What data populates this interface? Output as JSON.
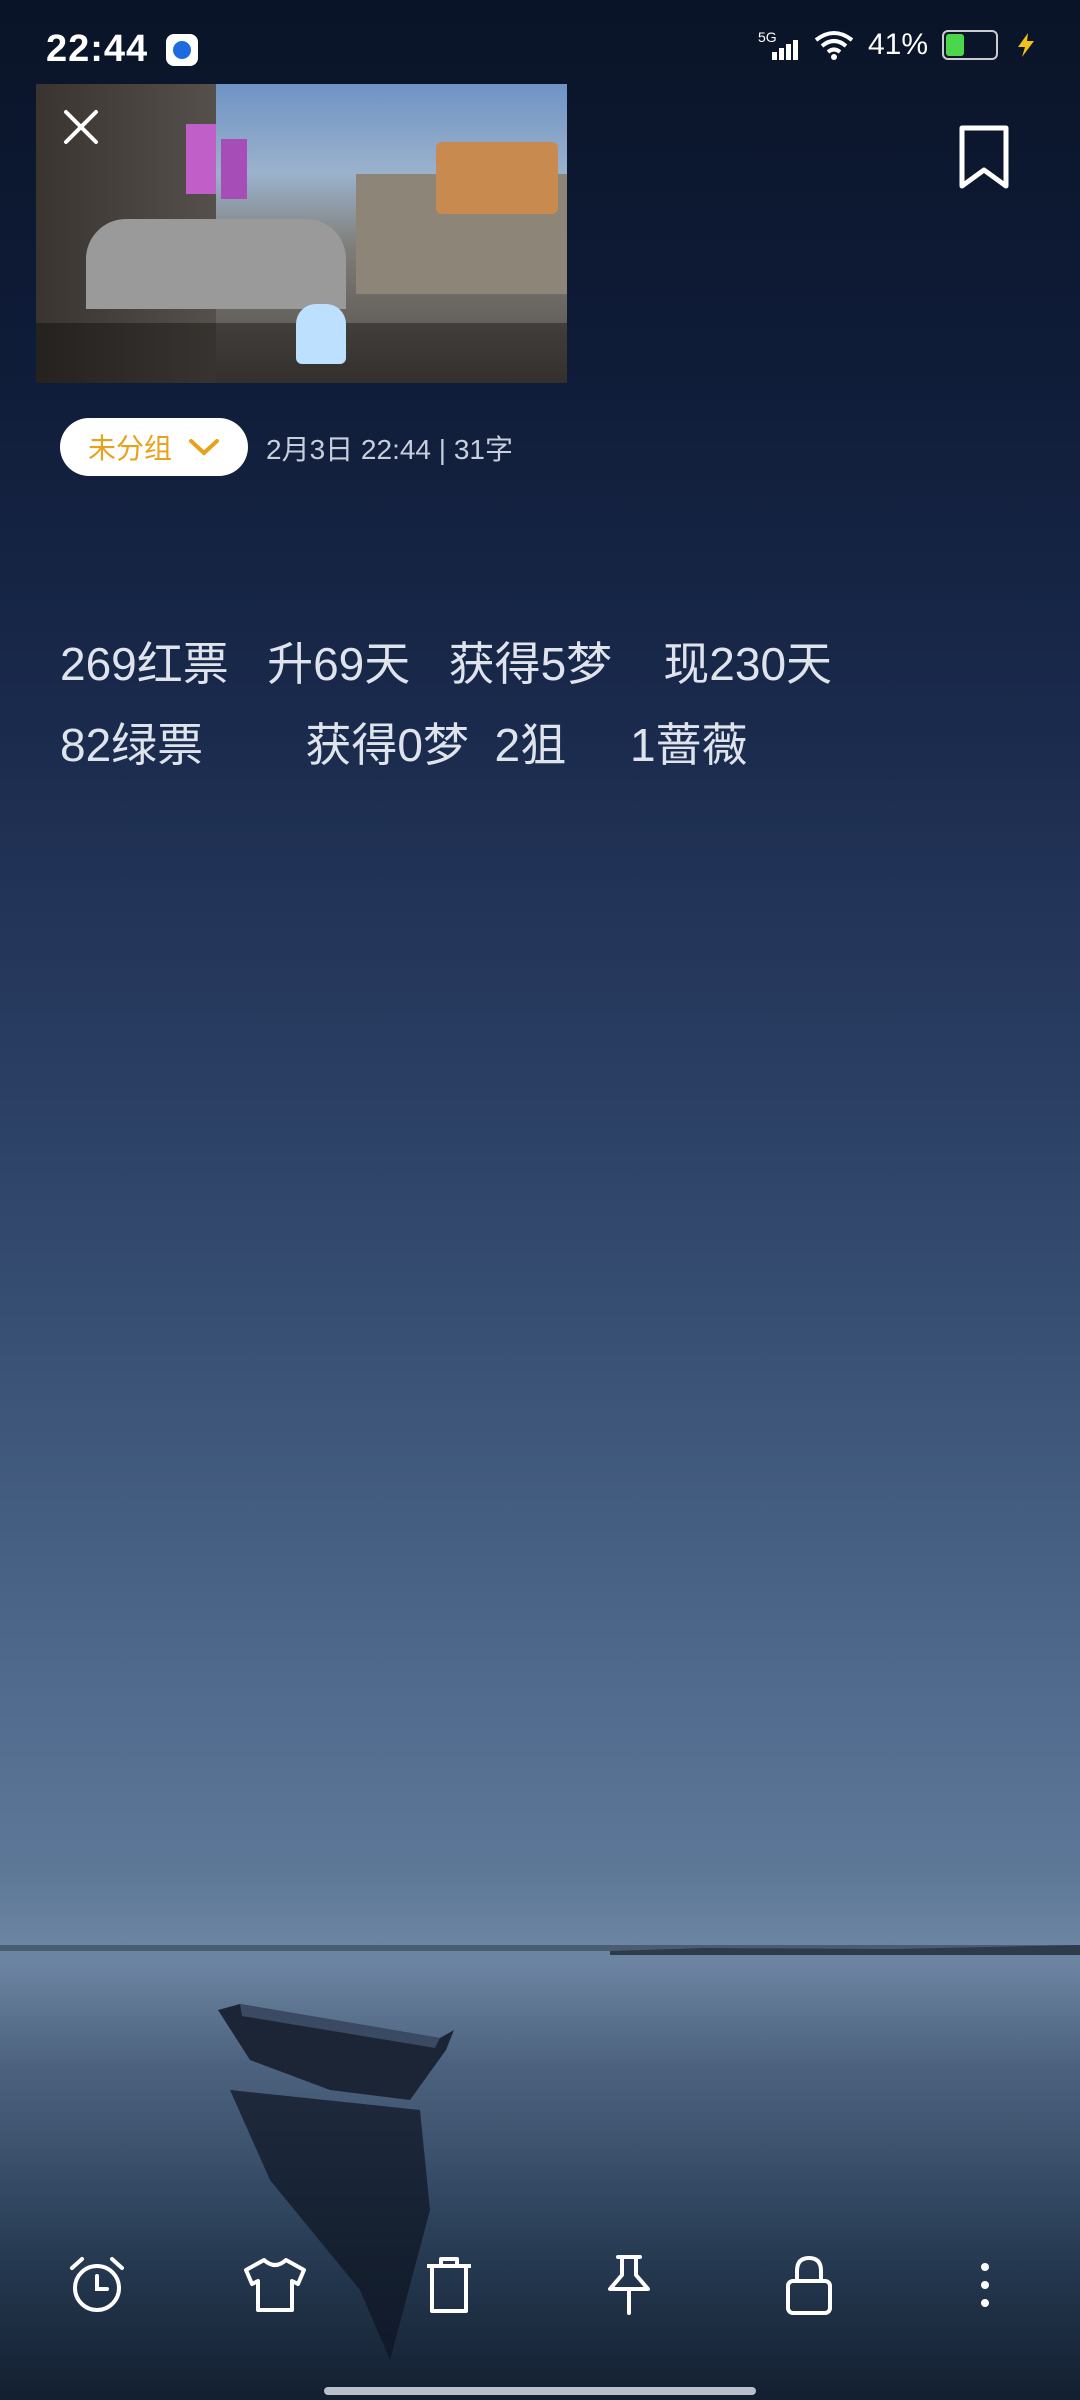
{
  "status_bar": {
    "time": "22:44",
    "network": "5G",
    "battery": "41%",
    "battery_level": 0.41
  },
  "note": {
    "category_chip": "未分组",
    "meta": "2月3日 22:44  |  31字",
    "lines": [
      "269红票   升69天   获得5梦    现230天",
      "82绿票        获得0梦  2狙     1蔷薇"
    ]
  },
  "icons": {
    "close": "close-icon",
    "bookmark": "bookmark-icon",
    "toolbar": [
      "alarm-icon",
      "shirt-icon",
      "trash-icon",
      "pin-icon",
      "lock-icon",
      "more-icon"
    ]
  }
}
